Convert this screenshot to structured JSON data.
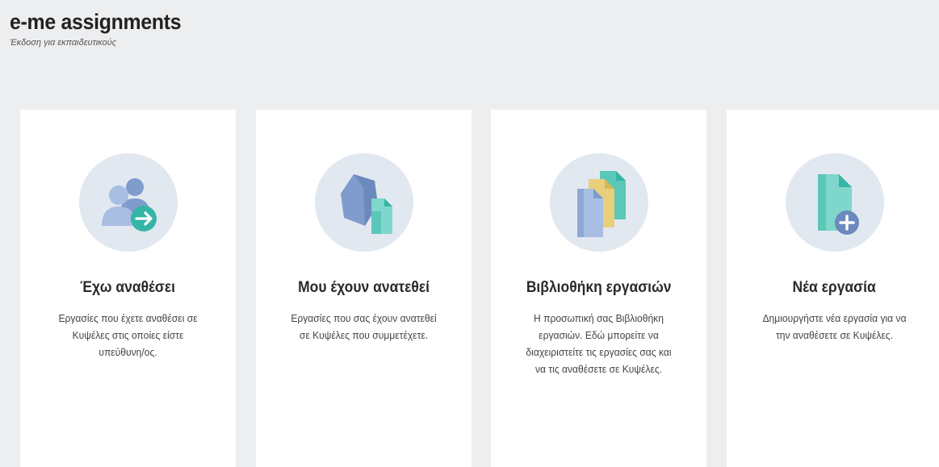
{
  "header": {
    "title": "e-me assignments",
    "subtitle": "Έκδοση για εκπαιδευτικούς"
  },
  "cards": [
    {
      "icon": "assigned-users-arrow-icon",
      "title": "Έχω αναθέσει",
      "description": "Εργασίες που έχετε αναθέσει σε Κυψέλες στις οποίες είστε υπεύθυνη/ος."
    },
    {
      "icon": "received-cube-document-icon",
      "title": "Μου έχουν ανατεθεί",
      "description": "Εργασίες που σας έχουν ανατεθεί σε Κυψέλες που συμμετέχετε."
    },
    {
      "icon": "document-stack-library-icon",
      "title": "Βιβλιοθήκη εργασιών",
      "description": "Η προσωπική σας Βιβλιοθήκη εργασιών. Εδώ μπορείτε να διαχειριστείτε τις εργασίες σας και να τις αναθέσετε σε Κυψέλες."
    },
    {
      "icon": "new-document-plus-icon",
      "title": "Νέα εργασία",
      "description": "Δημιουργήστε νέα εργασία για να την αναθέσετε σε Κυψέλες."
    }
  ],
  "colors": {
    "page_background": "#edeef0",
    "card_background": "#ffffff",
    "icon_circle": "#e2e8f0",
    "accent_teal": "#35b5a6",
    "accent_blue": "#7f9ccc",
    "accent_yellow": "#e8cf7c"
  }
}
